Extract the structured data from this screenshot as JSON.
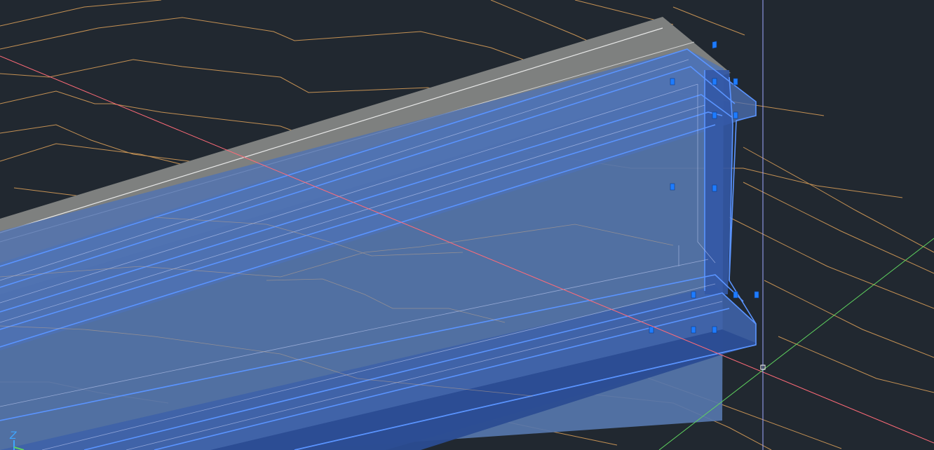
{
  "viewport": {
    "background": "#212830",
    "selection_color": "#4a8cff",
    "terrain_color": "#e0a35a",
    "existing_solid_color": "#8a8c8a",
    "x_axis_color": "#ff6b78",
    "y_axis_color": "#5fd35f",
    "crosshair_color": "#a0a8ff"
  },
  "ucs_icon": {
    "axis_label": "Z"
  }
}
